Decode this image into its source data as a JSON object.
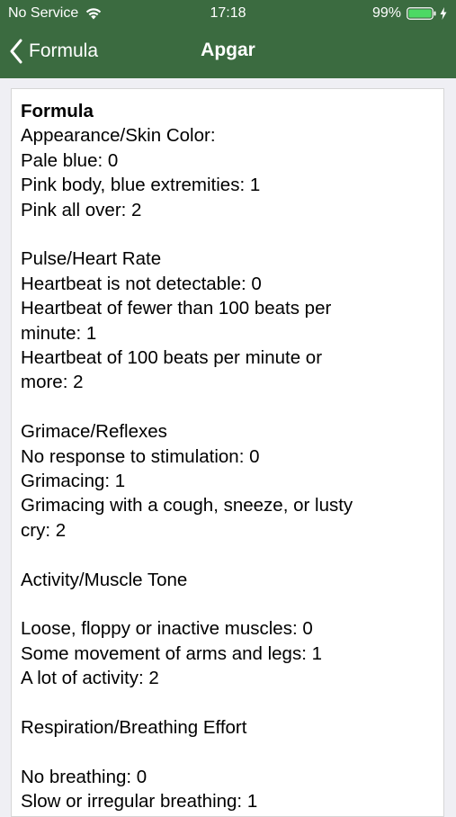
{
  "status_bar": {
    "carrier": "No Service",
    "time": "17:18",
    "battery": "99%",
    "icons": [
      "wifi-icon",
      "battery-icon",
      "charging-icon"
    ]
  },
  "nav": {
    "back_label": "Formula",
    "title": "Apgar",
    "icons": [
      "chevron-left-icon"
    ]
  },
  "colors": {
    "header_bg": "#3b6b40",
    "battery_fill": "#4cd964"
  },
  "formula": {
    "heading": "Formula",
    "appearance": {
      "title": "Appearance/Skin Color:",
      "items": [
        "Pale blue: 0",
        "Pink body, blue extremities: 1",
        "Pink all over: 2"
      ]
    },
    "pulse": {
      "title": "Pulse/Heart Rate",
      "items": [
        "Heartbeat is not detectable: 0",
        "Heartbeat of fewer than 100 beats per",
        "minute: 1",
        "Heartbeat of 100 beats per minute or",
        "more: 2"
      ]
    },
    "grimace": {
      "title": "Grimace/Reflexes",
      "items": [
        "No response to stimulation: 0",
        "Grimacing: 1",
        "Grimacing with a cough, sneeze, or lusty",
        "cry: 2"
      ]
    },
    "activity": {
      "title": "Activity/Muscle Tone",
      "items": [
        "Loose, floppy or inactive muscles: 0",
        "Some movement of arms and legs: 1",
        "A lot of activity: 2"
      ]
    },
    "respiration": {
      "title": "Respiration/Breathing Effort",
      "items": [
        "No breathing: 0",
        "Slow or irregular breathing: 1"
      ]
    }
  }
}
